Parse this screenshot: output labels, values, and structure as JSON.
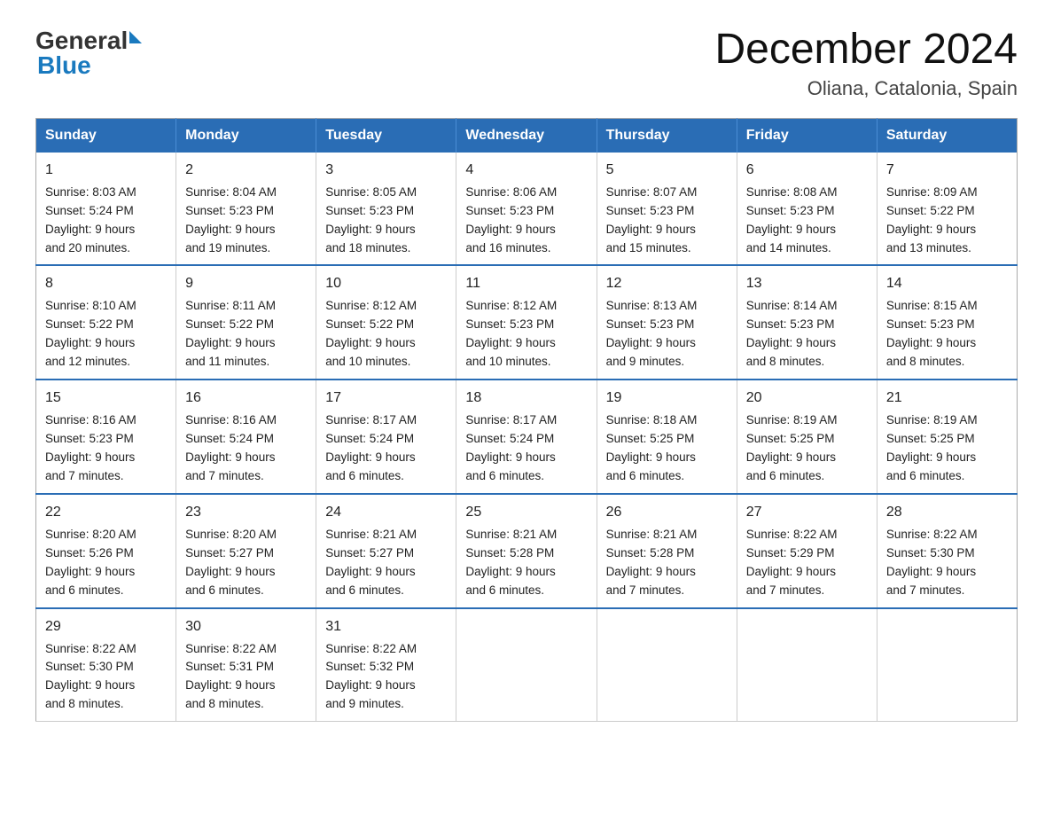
{
  "header": {
    "logo_general": "General",
    "logo_blue": "Blue",
    "title": "December 2024",
    "subtitle": "Oliana, Catalonia, Spain"
  },
  "columns": [
    "Sunday",
    "Monday",
    "Tuesday",
    "Wednesday",
    "Thursday",
    "Friday",
    "Saturday"
  ],
  "weeks": [
    [
      {
        "day": "1",
        "sunrise": "8:03 AM",
        "sunset": "5:24 PM",
        "daylight": "9 hours and 20 minutes."
      },
      {
        "day": "2",
        "sunrise": "8:04 AM",
        "sunset": "5:23 PM",
        "daylight": "9 hours and 19 minutes."
      },
      {
        "day": "3",
        "sunrise": "8:05 AM",
        "sunset": "5:23 PM",
        "daylight": "9 hours and 18 minutes."
      },
      {
        "day": "4",
        "sunrise": "8:06 AM",
        "sunset": "5:23 PM",
        "daylight": "9 hours and 16 minutes."
      },
      {
        "day": "5",
        "sunrise": "8:07 AM",
        "sunset": "5:23 PM",
        "daylight": "9 hours and 15 minutes."
      },
      {
        "day": "6",
        "sunrise": "8:08 AM",
        "sunset": "5:23 PM",
        "daylight": "9 hours and 14 minutes."
      },
      {
        "day": "7",
        "sunrise": "8:09 AM",
        "sunset": "5:22 PM",
        "daylight": "9 hours and 13 minutes."
      }
    ],
    [
      {
        "day": "8",
        "sunrise": "8:10 AM",
        "sunset": "5:22 PM",
        "daylight": "9 hours and 12 minutes."
      },
      {
        "day": "9",
        "sunrise": "8:11 AM",
        "sunset": "5:22 PM",
        "daylight": "9 hours and 11 minutes."
      },
      {
        "day": "10",
        "sunrise": "8:12 AM",
        "sunset": "5:22 PM",
        "daylight": "9 hours and 10 minutes."
      },
      {
        "day": "11",
        "sunrise": "8:12 AM",
        "sunset": "5:23 PM",
        "daylight": "9 hours and 10 minutes."
      },
      {
        "day": "12",
        "sunrise": "8:13 AM",
        "sunset": "5:23 PM",
        "daylight": "9 hours and 9 minutes."
      },
      {
        "day": "13",
        "sunrise": "8:14 AM",
        "sunset": "5:23 PM",
        "daylight": "9 hours and 8 minutes."
      },
      {
        "day": "14",
        "sunrise": "8:15 AM",
        "sunset": "5:23 PM",
        "daylight": "9 hours and 8 minutes."
      }
    ],
    [
      {
        "day": "15",
        "sunrise": "8:16 AM",
        "sunset": "5:23 PM",
        "daylight": "9 hours and 7 minutes."
      },
      {
        "day": "16",
        "sunrise": "8:16 AM",
        "sunset": "5:24 PM",
        "daylight": "9 hours and 7 minutes."
      },
      {
        "day": "17",
        "sunrise": "8:17 AM",
        "sunset": "5:24 PM",
        "daylight": "9 hours and 6 minutes."
      },
      {
        "day": "18",
        "sunrise": "8:17 AM",
        "sunset": "5:24 PM",
        "daylight": "9 hours and 6 minutes."
      },
      {
        "day": "19",
        "sunrise": "8:18 AM",
        "sunset": "5:25 PM",
        "daylight": "9 hours and 6 minutes."
      },
      {
        "day": "20",
        "sunrise": "8:19 AM",
        "sunset": "5:25 PM",
        "daylight": "9 hours and 6 minutes."
      },
      {
        "day": "21",
        "sunrise": "8:19 AM",
        "sunset": "5:25 PM",
        "daylight": "9 hours and 6 minutes."
      }
    ],
    [
      {
        "day": "22",
        "sunrise": "8:20 AM",
        "sunset": "5:26 PM",
        "daylight": "9 hours and 6 minutes."
      },
      {
        "day": "23",
        "sunrise": "8:20 AM",
        "sunset": "5:27 PM",
        "daylight": "9 hours and 6 minutes."
      },
      {
        "day": "24",
        "sunrise": "8:21 AM",
        "sunset": "5:27 PM",
        "daylight": "9 hours and 6 minutes."
      },
      {
        "day": "25",
        "sunrise": "8:21 AM",
        "sunset": "5:28 PM",
        "daylight": "9 hours and 6 minutes."
      },
      {
        "day": "26",
        "sunrise": "8:21 AM",
        "sunset": "5:28 PM",
        "daylight": "9 hours and 7 minutes."
      },
      {
        "day": "27",
        "sunrise": "8:22 AM",
        "sunset": "5:29 PM",
        "daylight": "9 hours and 7 minutes."
      },
      {
        "day": "28",
        "sunrise": "8:22 AM",
        "sunset": "5:30 PM",
        "daylight": "9 hours and 7 minutes."
      }
    ],
    [
      {
        "day": "29",
        "sunrise": "8:22 AM",
        "sunset": "5:30 PM",
        "daylight": "9 hours and 8 minutes."
      },
      {
        "day": "30",
        "sunrise": "8:22 AM",
        "sunset": "5:31 PM",
        "daylight": "9 hours and 8 minutes."
      },
      {
        "day": "31",
        "sunrise": "8:22 AM",
        "sunset": "5:32 PM",
        "daylight": "9 hours and 9 minutes."
      },
      null,
      null,
      null,
      null
    ]
  ]
}
